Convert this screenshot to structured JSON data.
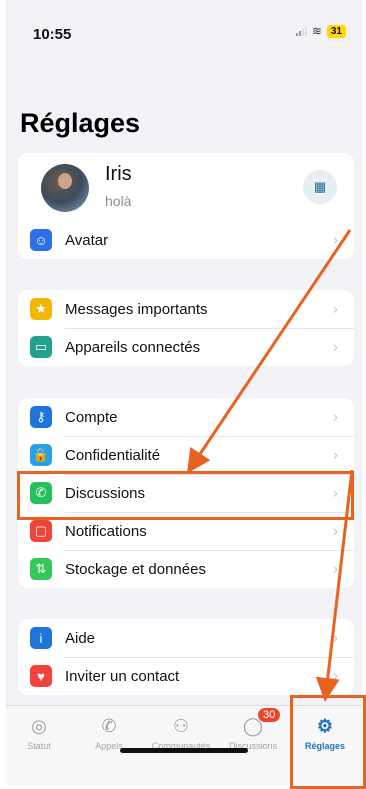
{
  "status_bar": {
    "time": "10:55",
    "battery": "31",
    "signal": "signal",
    "wifi": "wifi"
  },
  "page_title": "Réglages",
  "profile": {
    "name": "Iris",
    "status": "holà",
    "qr_icon": "qr-code-icon"
  },
  "groups": [
    [
      {
        "id": "avatar",
        "label": "Avatar",
        "icon": "avatar-icon",
        "color": "#2f6fe5",
        "glyph": "☺"
      }
    ],
    [
      {
        "id": "messages-importants",
        "label": "Messages importants",
        "icon": "star-icon",
        "color": "#f2b705",
        "glyph": "★"
      },
      {
        "id": "appareils-connectes",
        "label": "Appareils connectés",
        "icon": "laptop-icon",
        "color": "#23a18c",
        "glyph": "▭"
      }
    ],
    [
      {
        "id": "compte",
        "label": "Compte",
        "icon": "key-icon",
        "color": "#1e74d8",
        "glyph": "⚷"
      },
      {
        "id": "confidentialite",
        "label": "Confidentialité",
        "icon": "lock-icon",
        "color": "#2aa0e6",
        "glyph": "🔒"
      },
      {
        "id": "discussions",
        "label": "Discussions",
        "icon": "whatsapp-icon",
        "color": "#25c05c",
        "glyph": "✆"
      },
      {
        "id": "notifications",
        "label": "Notifications",
        "icon": "notification-icon",
        "color": "#f0433a",
        "glyph": "▢"
      },
      {
        "id": "stockage",
        "label": "Stockage et données",
        "icon": "arrows-updown-icon",
        "color": "#34c759",
        "glyph": "⇅"
      }
    ],
    [
      {
        "id": "aide",
        "label": "Aide",
        "icon": "info-icon",
        "color": "#1e74d8",
        "glyph": "i"
      },
      {
        "id": "inviter",
        "label": "Inviter un contact",
        "icon": "heart-icon",
        "color": "#f0433a",
        "glyph": "♥"
      }
    ]
  ],
  "tabbar": [
    {
      "id": "statut",
      "label": "Statut",
      "icon": "status-ring-icon",
      "glyph": "◎"
    },
    {
      "id": "appels",
      "label": "Appels",
      "icon": "phone-icon",
      "glyph": "✆"
    },
    {
      "id": "communautes",
      "label": "Communautés",
      "icon": "community-icon",
      "glyph": "⚇"
    },
    {
      "id": "discussions",
      "label": "Discussions",
      "icon": "chat-bubble-icon",
      "glyph": "◯",
      "badge": "30"
    },
    {
      "id": "reglages",
      "label": "Réglages",
      "icon": "gear-icon",
      "glyph": "⚙",
      "active": true
    }
  ],
  "annotation": {
    "color": "#e9621f"
  }
}
